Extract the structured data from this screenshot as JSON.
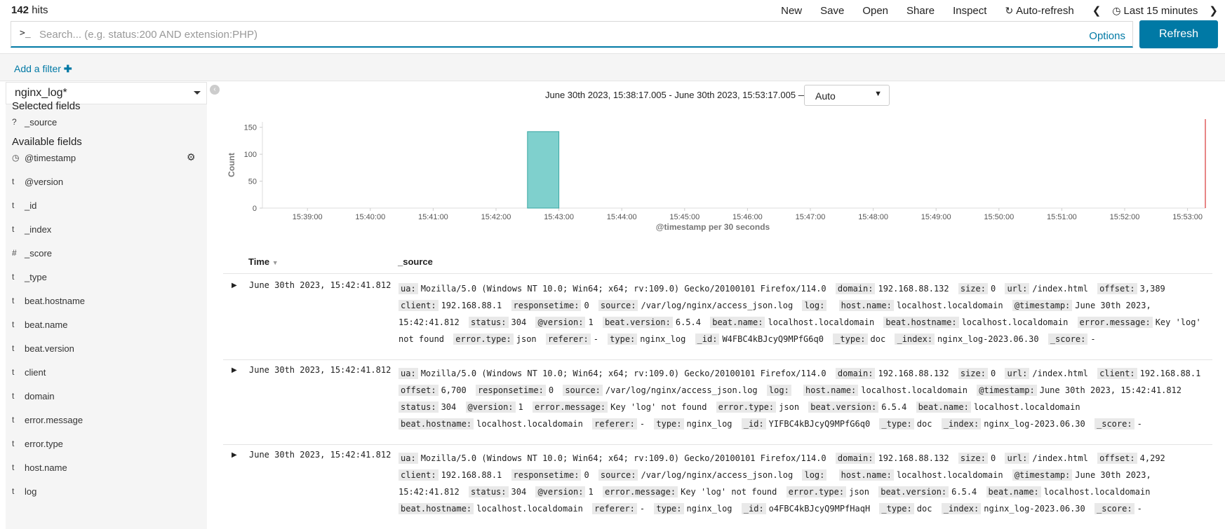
{
  "header": {
    "hits_count": "142",
    "hits_label": "hits",
    "menu": [
      "New",
      "Save",
      "Open",
      "Share",
      "Inspect"
    ],
    "auto_refresh": "Auto-refresh",
    "time_picker": "Last 15 minutes"
  },
  "query": {
    "prompt": ">_",
    "placeholder": "Search... (e.g. status:200 AND extension:PHP)",
    "value": "",
    "options_label": "Options",
    "refresh_label": "Refresh"
  },
  "filter": {
    "add_label": "Add a filter"
  },
  "sidebar": {
    "index_pattern": "nginx_log*",
    "selected_title": "Selected fields",
    "selected_fields": [
      {
        "type": "?",
        "name": "_source"
      }
    ],
    "available_title": "Available fields",
    "available_fields": [
      {
        "type": "clock",
        "name": "@timestamp"
      },
      {
        "type": "t",
        "name": "@version"
      },
      {
        "type": "t",
        "name": "_id"
      },
      {
        "type": "t",
        "name": "_index"
      },
      {
        "type": "#",
        "name": "_score"
      },
      {
        "type": "t",
        "name": "_type"
      },
      {
        "type": "t",
        "name": "beat.hostname"
      },
      {
        "type": "t",
        "name": "beat.name"
      },
      {
        "type": "t",
        "name": "beat.version"
      },
      {
        "type": "t",
        "name": "client"
      },
      {
        "type": "t",
        "name": "domain"
      },
      {
        "type": "t",
        "name": "error.message"
      },
      {
        "type": "t",
        "name": "error.type"
      },
      {
        "type": "t",
        "name": "host.name"
      },
      {
        "type": "t",
        "name": "log"
      }
    ]
  },
  "main": {
    "time_range": "June 30th 2023, 15:38:17.005 - June 30th 2023, 15:53:17.005 —",
    "interval": "Auto"
  },
  "chart_data": {
    "type": "bar",
    "ylabel": "Count",
    "xlabel": "@timestamp per 30 seconds",
    "ylim": [
      0,
      160
    ],
    "yticks": [
      0,
      50,
      100,
      150
    ],
    "xticks": [
      "15:39:00",
      "15:40:00",
      "15:41:00",
      "15:42:00",
      "15:43:00",
      "15:44:00",
      "15:45:00",
      "15:46:00",
      "15:47:00",
      "15:48:00",
      "15:49:00",
      "15:50:00",
      "15:51:00",
      "15:52:00",
      "15:53:00"
    ],
    "bars": [
      {
        "start": "15:42:30",
        "end": "15:43:00",
        "value": 142
      }
    ],
    "bar_color": "#7fd0cd",
    "now_line_color": "#e05d5d"
  },
  "table": {
    "col_time": "Time",
    "col_source": "_source",
    "rows": [
      {
        "time": "June 30th 2023, 15:42:41.812",
        "fields": [
          [
            "ua:",
            "Mozilla/5.0 (Windows NT 10.0; Win64; x64; rv:109.0) Gecko/20100101 Firefox/114.0"
          ],
          [
            "domain:",
            "192.168.88.132"
          ],
          [
            "size:",
            "0"
          ],
          [
            "url:",
            "/index.html"
          ],
          [
            "offset:",
            "3,389"
          ],
          [
            "client:",
            "192.168.88.1"
          ],
          [
            "responsetime:",
            "0"
          ],
          [
            "source:",
            "/var/log/nginx/access_json.log"
          ],
          [
            "log:",
            ""
          ],
          [
            "host.name:",
            "localhost.localdomain"
          ],
          [
            "@timestamp:",
            "June 30th 2023, 15:42:41.812"
          ],
          [
            "status:",
            "304"
          ],
          [
            "@version:",
            "1"
          ],
          [
            "beat.version:",
            "6.5.4"
          ],
          [
            "beat.name:",
            "localhost.localdomain"
          ],
          [
            "beat.hostname:",
            "localhost.localdomain"
          ],
          [
            "error.message:",
            "Key 'log' not found"
          ],
          [
            "error.type:",
            "json"
          ],
          [
            "referer:",
            "-"
          ],
          [
            "type:",
            "nginx_log"
          ],
          [
            "_id:",
            "W4FBC4kBJcyQ9MPfG6q0"
          ],
          [
            "_type:",
            "doc"
          ],
          [
            "_index:",
            "nginx_log-2023.06.30"
          ],
          [
            "_score:",
            "-"
          ]
        ]
      },
      {
        "time": "June 30th 2023, 15:42:41.812",
        "fields": [
          [
            "ua:",
            "Mozilla/5.0 (Windows NT 10.0; Win64; x64; rv:109.0) Gecko/20100101 Firefox/114.0"
          ],
          [
            "domain:",
            "192.168.88.132"
          ],
          [
            "size:",
            "0"
          ],
          [
            "url:",
            "/index.html"
          ],
          [
            "client:",
            "192.168.88.1"
          ],
          [
            "offset:",
            "6,700"
          ],
          [
            "responsetime:",
            "0"
          ],
          [
            "source:",
            "/var/log/nginx/access_json.log"
          ],
          [
            "log:",
            ""
          ],
          [
            "host.name:",
            "localhost.localdomain"
          ],
          [
            "@timestamp:",
            "June 30th 2023, 15:42:41.812"
          ],
          [
            "status:",
            "304"
          ],
          [
            "@version:",
            "1"
          ],
          [
            "error.message:",
            "Key 'log' not found"
          ],
          [
            "error.type:",
            "json"
          ],
          [
            "beat.version:",
            "6.5.4"
          ],
          [
            "beat.name:",
            "localhost.localdomain"
          ],
          [
            "beat.hostname:",
            "localhost.localdomain"
          ],
          [
            "referer:",
            "-"
          ],
          [
            "type:",
            "nginx_log"
          ],
          [
            "_id:",
            "YIFBC4kBJcyQ9MPfG6q0"
          ],
          [
            "_type:",
            "doc"
          ],
          [
            "_index:",
            "nginx_log-2023.06.30"
          ],
          [
            "_score:",
            "-"
          ]
        ]
      },
      {
        "time": "June 30th 2023, 15:42:41.812",
        "fields": [
          [
            "ua:",
            "Mozilla/5.0 (Windows NT 10.0; Win64; x64; rv:109.0) Gecko/20100101 Firefox/114.0"
          ],
          [
            "domain:",
            "192.168.88.132"
          ],
          [
            "size:",
            "0"
          ],
          [
            "url:",
            "/index.html"
          ],
          [
            "offset:",
            "4,292"
          ],
          [
            "client:",
            "192.168.88.1"
          ],
          [
            "responsetime:",
            "0"
          ],
          [
            "source:",
            "/var/log/nginx/access_json.log"
          ],
          [
            "log:",
            ""
          ],
          [
            "host.name:",
            "localhost.localdomain"
          ],
          [
            "@timestamp:",
            "June 30th 2023, 15:42:41.812"
          ],
          [
            "status:",
            "304"
          ],
          [
            "@version:",
            "1"
          ],
          [
            "error.message:",
            "Key 'log' not found"
          ],
          [
            "error.type:",
            "json"
          ],
          [
            "beat.version:",
            "6.5.4"
          ],
          [
            "beat.name:",
            "localhost.localdomain"
          ],
          [
            "beat.hostname:",
            "localhost.localdomain"
          ],
          [
            "referer:",
            "-"
          ],
          [
            "type:",
            "nginx_log"
          ],
          [
            "_id:",
            "o4FBC4kBJcyQ9MPfHaqH"
          ],
          [
            "_type:",
            "doc"
          ],
          [
            "_index:",
            "nginx_log-2023.06.30"
          ],
          [
            "_score:",
            "-"
          ]
        ]
      }
    ]
  }
}
